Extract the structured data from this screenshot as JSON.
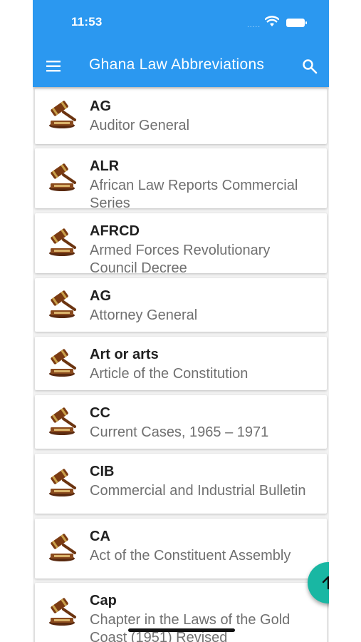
{
  "status_bar": {
    "time": "11:53",
    "dots": "....."
  },
  "app_bar": {
    "title": "Ghana Law Abbreviations"
  },
  "items": [
    {
      "abbr": "AG",
      "meaning": "Auditor General"
    },
    {
      "abbr": "ALR",
      "meaning": "African Law Reports Commercial Series"
    },
    {
      "abbr": "AFRCD",
      "meaning": "Armed Forces Revolutionary Council Decree"
    },
    {
      "abbr": "AG",
      "meaning": "Attorney General"
    },
    {
      "abbr": "Art or arts",
      "meaning": "Article of the Constitution"
    },
    {
      "abbr": "CC",
      "meaning": "Current Cases, 1965 – 1971"
    },
    {
      "abbr": "CIB",
      "meaning": "Commercial and Industrial Bulletin"
    },
    {
      "abbr": "CA",
      "meaning": "Act of the Constituent Assembly"
    },
    {
      "abbr": "Cap",
      "meaning": "Chapter in the Laws of the Gold Coast (1951) Revised"
    }
  ],
  "colors": {
    "appbar": "#2b98f0",
    "fab": "#19b7a3"
  },
  "icons": {
    "menu": "menu-icon",
    "search": "search-icon",
    "item": "gavel-icon",
    "fab": "arrow-up-icon"
  }
}
